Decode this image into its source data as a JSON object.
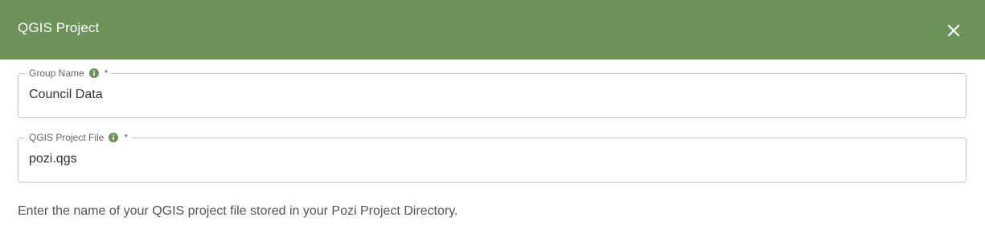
{
  "header": {
    "title": "QGIS Project",
    "background_color": "#6e935a",
    "close_icon": "close-icon"
  },
  "form": {
    "group_name": {
      "label": "Group Name",
      "required_mark": "*",
      "value": "Council Data",
      "info_icon": "info-icon"
    },
    "qgis_project_file": {
      "label": "QGIS Project File",
      "required_mark": "*",
      "value": "pozi.qgs",
      "info_icon": "info-icon"
    },
    "helper_text": "Enter the name of your QGIS project file stored in your Pozi Project Directory."
  }
}
